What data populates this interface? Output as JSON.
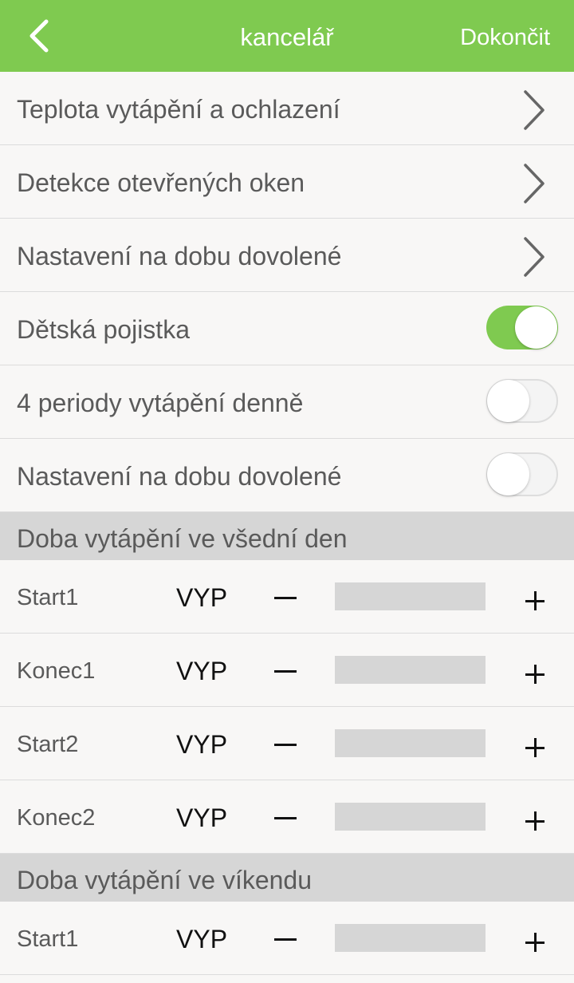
{
  "header": {
    "title": "kancelář",
    "done_label": "Dokončit",
    "background_color": "#7fca50",
    "back_icon": "chevron-left-icon"
  },
  "settings": {
    "nav_items": [
      {
        "label": "Teplota vytápění a ochlazení",
        "icon": "chevron-right-icon"
      },
      {
        "label": "Detekce otevřených oken",
        "icon": "chevron-right-icon"
      },
      {
        "label": "Nastavení na dobu dovolené",
        "icon": "chevron-right-icon"
      }
    ],
    "toggles": [
      {
        "label": "Dětská pojistka",
        "on": true
      },
      {
        "label": "4 periody vytápění denně",
        "on": false
      },
      {
        "label": "Nastavení na dobu dovolené",
        "on": false
      }
    ]
  },
  "weekday": {
    "title": "Doba vytápění ve všední den",
    "rows": [
      {
        "label": "Start1",
        "value": "VYP"
      },
      {
        "label": "Konec1",
        "value": "VYP"
      },
      {
        "label": "Start2",
        "value": "VYP"
      },
      {
        "label": "Konec2",
        "value": "VYP"
      }
    ]
  },
  "weekend": {
    "title": "Doba vytápění ve víkendu",
    "rows": [
      {
        "label": "Start1",
        "value": "VYP"
      }
    ]
  }
}
